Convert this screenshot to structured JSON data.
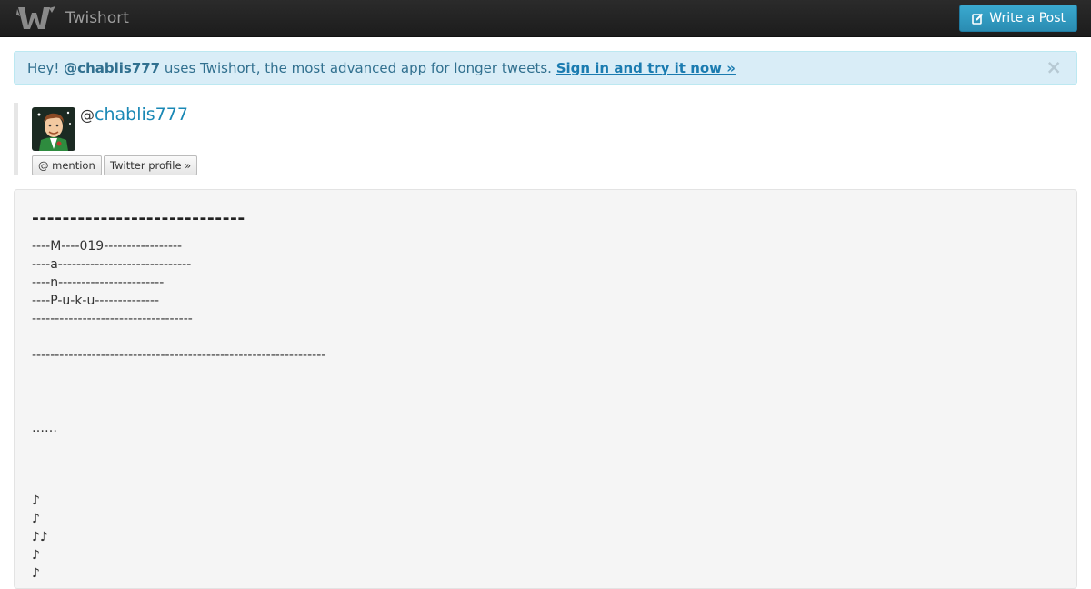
{
  "navbar": {
    "brand": "Twishort",
    "write_button": "Write a Post"
  },
  "alert": {
    "greeting": "Hey! ",
    "username": "@chablis777",
    "message": " uses Twishort, the most advanced app for longer tweets. ",
    "link": "Sign in and try it now »",
    "close": "×"
  },
  "profile": {
    "at": "@",
    "username": "chablis777",
    "mention_button": "@ mention",
    "twitter_button": "Twitter profile »"
  },
  "post": {
    "heading": "----------------------------",
    "lines": [
      "----M----019-----------------",
      "----a-----------------------------",
      "----n-----------------------",
      "----P-u-k-u--------------",
      "-----------------------------------",
      "",
      "----------------------------------------------------------------",
      "",
      "",
      "",
      "……",
      "",
      "",
      "",
      "♪",
      "♪",
      "♪♪",
      "♪",
      "♪"
    ]
  },
  "colors": {
    "navbar_bg": "#222222",
    "accent": "#2a9fd6",
    "alert_bg": "#d9edf7",
    "alert_text": "#31708f",
    "link": "#1a88b5",
    "post_bg": "#f5f5f5"
  },
  "icons": {
    "brand": "twishort-bird-logo",
    "write": "edit-icon",
    "close": "close-icon"
  }
}
